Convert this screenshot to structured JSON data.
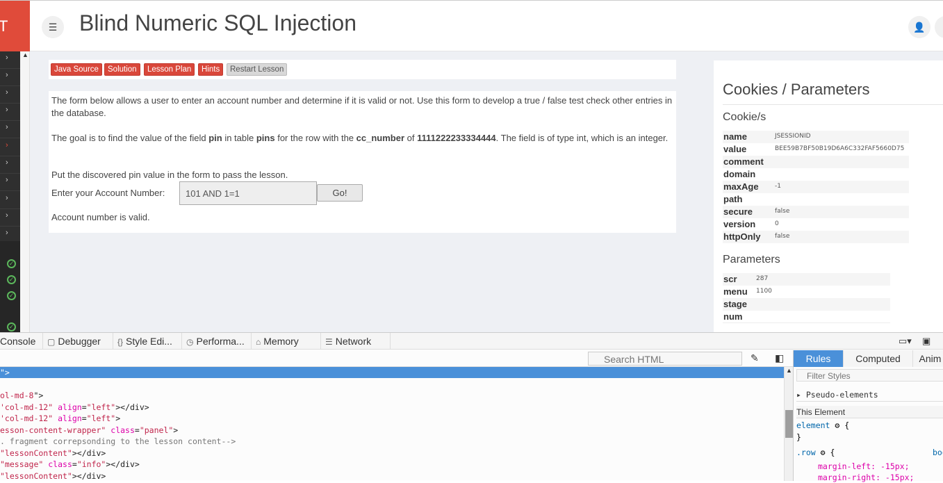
{
  "header": {
    "logo_text": "T",
    "title": "Blind Numeric SQL Injection"
  },
  "lesson_buttons": [
    {
      "label": "Java Source"
    },
    {
      "label": "Solution"
    },
    {
      "label": "Lesson Plan"
    },
    {
      "label": "Hints"
    },
    {
      "label": "Restart Lesson"
    }
  ],
  "lesson": {
    "intro": "The form below allows a user to enter an account number and determine if it is valid or not. Use this form to develop a true / false test check other entries in the database.",
    "goal_1": "The goal is to find the value of the field ",
    "goal_field": "pin",
    "goal_2": " in table ",
    "goal_table": "pins",
    "goal_3": " for the row with the ",
    "goal_col": "cc_number",
    "goal_4": " of ",
    "goal_val": "1111222233334444",
    "goal_5": ". The field is of type int, which is an integer.",
    "instruction": "Put the discovered pin value in the form to pass the lesson.",
    "account_label": "Enter your Account Number:",
    "account_value": "101 AND 1=1",
    "go_label": "Go!",
    "result": "Account number is valid."
  },
  "cookies_panel": {
    "title": "Cookies / Parameters",
    "cookies_heading": "Cookie/s",
    "cookies": [
      {
        "k": "name",
        "v": "JSESSIONID"
      },
      {
        "k": "value",
        "v": "BEE59B7BF50B19D6A6C332FAF5660D75"
      },
      {
        "k": "comment",
        "v": ""
      },
      {
        "k": "domain",
        "v": ""
      },
      {
        "k": "maxAge",
        "v": "-1"
      },
      {
        "k": "path",
        "v": ""
      },
      {
        "k": "secure",
        "v": "false"
      },
      {
        "k": "version",
        "v": "0"
      },
      {
        "k": "httpOnly",
        "v": "false"
      }
    ],
    "params_heading": "Parameters",
    "params": [
      {
        "k": "scr",
        "v": "287"
      },
      {
        "k": "menu",
        "v": "1100"
      },
      {
        "k": "stage",
        "v": ""
      },
      {
        "k": "num",
        "v": ""
      }
    ]
  },
  "devtools": {
    "tabs": [
      {
        "label": "Console",
        "icon": ""
      },
      {
        "label": "Debugger",
        "icon": "debugger-icon"
      },
      {
        "label": "Style Edi...",
        "icon": "style-editor-icon"
      },
      {
        "label": "Performa...",
        "icon": "performance-icon"
      },
      {
        "label": "Memory",
        "icon": "memory-icon"
      },
      {
        "label": "Network",
        "icon": "network-icon"
      }
    ],
    "search_placeholder": "Search HTML",
    "markup_lines": [
      {
        "parts": [
          [
            "attr-v",
            "\">"
          ]
        ],
        "selected": true
      },
      {
        "parts": [
          [
            "",
            ""
          ]
        ]
      },
      {
        "parts": [
          [
            "attr-v",
            "ol-md-8"
          ],
          [
            "",
            "\">"
          ]
        ]
      },
      {
        "parts": [
          [
            "attr-v",
            "'col-md-12\""
          ],
          [
            "",
            " "
          ],
          [
            "attr-n",
            "align"
          ],
          [
            "",
            "="
          ],
          [
            "attr-v",
            "\"left\""
          ],
          [
            "",
            "></div>"
          ]
        ]
      },
      {
        "parts": [
          [
            "attr-v",
            "'col-md-12\""
          ],
          [
            "",
            " "
          ],
          [
            "attr-n",
            "align"
          ],
          [
            "",
            "="
          ],
          [
            "attr-v",
            "\"left\""
          ],
          [
            "",
            ">"
          ]
        ]
      },
      {
        "parts": [
          [
            "attr-v",
            "esson-content-wrapper\""
          ],
          [
            "",
            " "
          ],
          [
            "attr-n",
            "class"
          ],
          [
            "",
            "="
          ],
          [
            "attr-v",
            "\"panel\""
          ],
          [
            "",
            ">"
          ]
        ]
      },
      {
        "parts": [
          [
            "comment",
            ". fragment correpsonding to the lesson content-->"
          ]
        ]
      },
      {
        "parts": [
          [
            "attr-v",
            "\"lessonContent\""
          ],
          [
            "",
            "></div>"
          ]
        ]
      },
      {
        "parts": [
          [
            "attr-v",
            "\"message\""
          ],
          [
            "",
            " "
          ],
          [
            "attr-n",
            "class"
          ],
          [
            "",
            "="
          ],
          [
            "attr-v",
            "\"info\""
          ],
          [
            "",
            "></div>"
          ]
        ]
      },
      {
        "parts": [
          [
            "attr-v",
            "\"lessonContent\""
          ],
          [
            "",
            "></div>"
          ]
        ]
      }
    ],
    "rules_tabs": [
      {
        "label": "Rules",
        "active": true
      },
      {
        "label": "Computed",
        "active": false
      },
      {
        "label": "Anim",
        "active": false
      }
    ],
    "filter_placeholder": "Filter Styles",
    "pseudo_label": "Pseudo-elements",
    "this_element_label": "This Element",
    "rule_element": "element",
    "rule_row": ".row",
    "rule_row_src": "boo",
    "margin_left": "margin-left: -15px;",
    "margin_right": "margin-right: -15px;"
  }
}
